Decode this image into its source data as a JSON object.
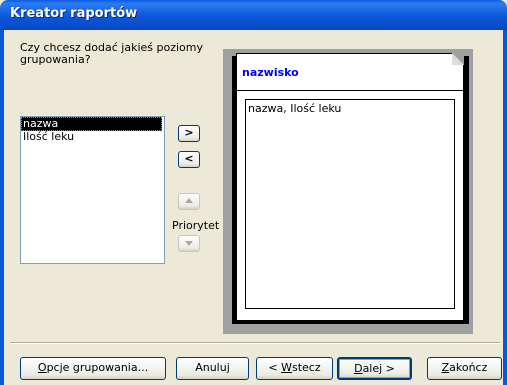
{
  "window": {
    "title": "Kreator raportów"
  },
  "prompt": {
    "line1": "Czy chcesz dodać jakieś poziomy",
    "line2": "grupowania?"
  },
  "fields_list": {
    "items": [
      "nazwa",
      "Ilość leku"
    ],
    "selected": "nazwa"
  },
  "arrows": {
    "add": ">",
    "remove": "<",
    "priority_label": "Priorytet"
  },
  "preview": {
    "group_header": "nazwisko",
    "detail_fields": "nazwa, Ilość leku"
  },
  "buttons": {
    "grouping_options": {
      "mnemonic": "O",
      "rest": "pcje grupowania..."
    },
    "cancel": "Anuluj",
    "back": {
      "prefix": "< ",
      "mnemonic": "W",
      "rest": "stecz"
    },
    "next": {
      "mnemonic": "D",
      "rest": "alej >"
    },
    "finish": {
      "mnemonic": "Z",
      "rest": "akończ"
    }
  },
  "colors": {
    "titlebar": "#0A58D8",
    "dialog_bg": "#ECE9D8",
    "header_text": "#0000FF"
  }
}
